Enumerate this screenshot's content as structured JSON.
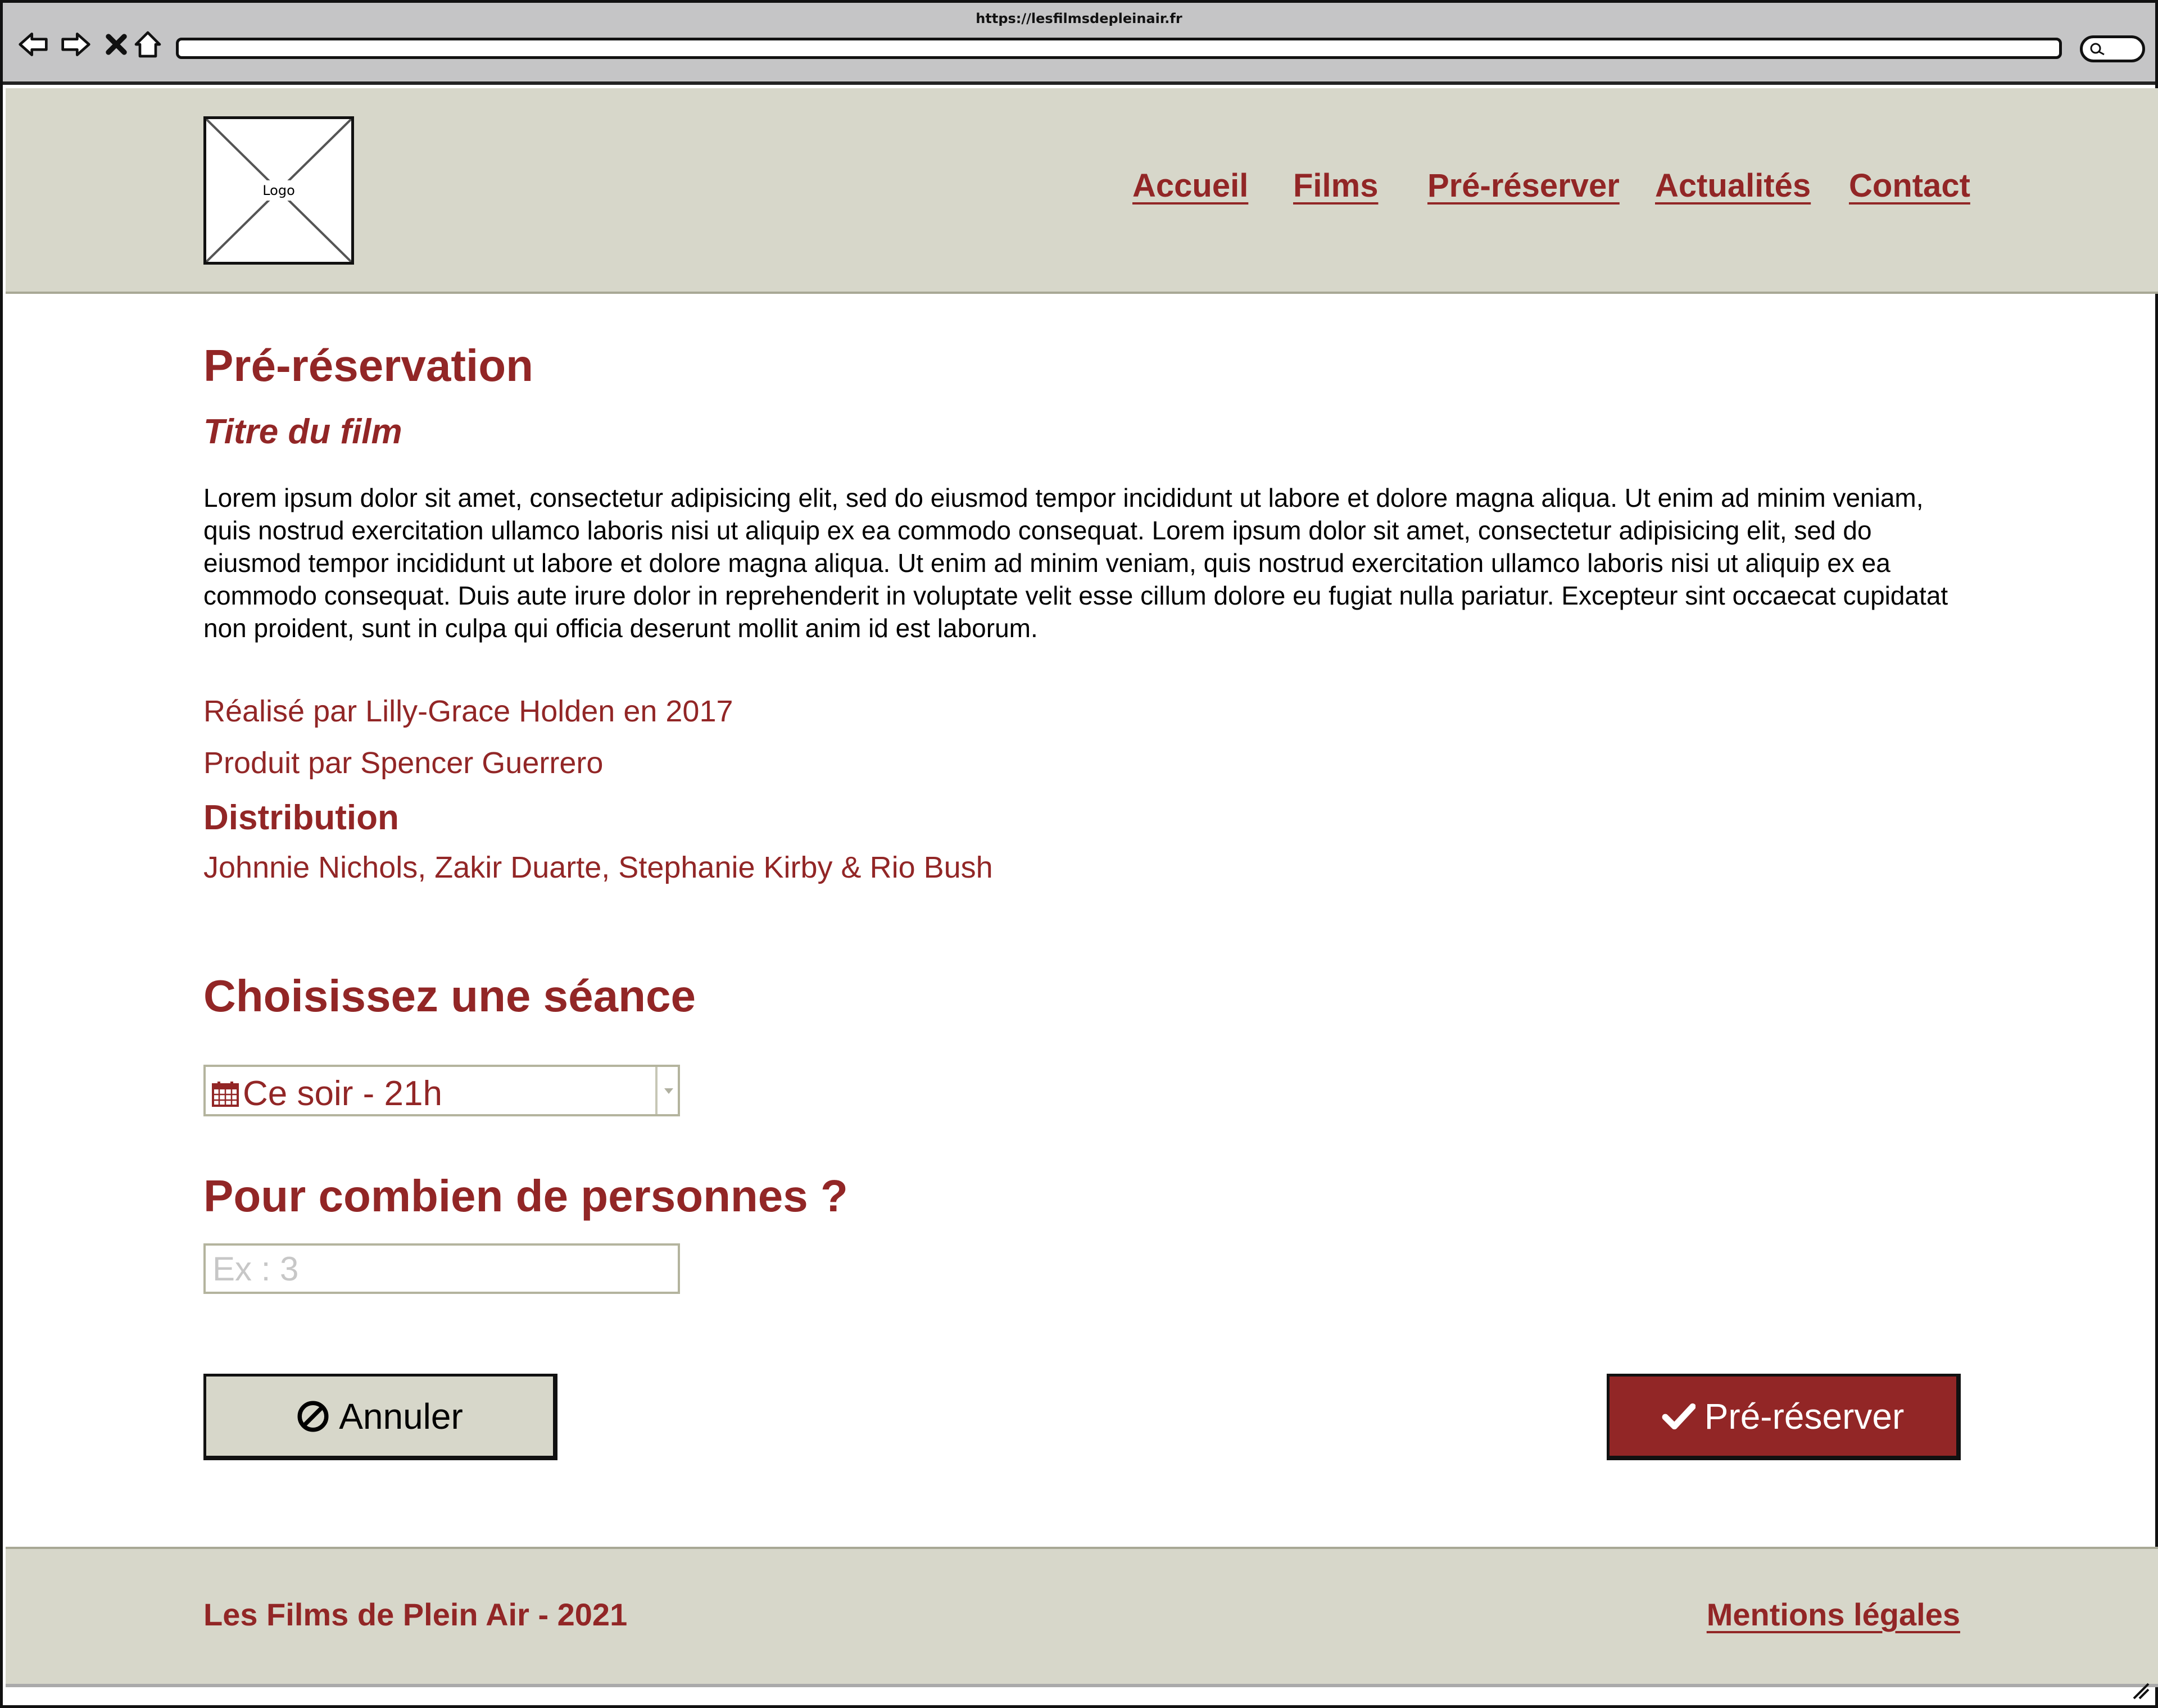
{
  "browser": {
    "url": "https://lesfilmsdepleinair.fr"
  },
  "header": {
    "logo_label": "Logo",
    "nav": [
      {
        "label": "Accueil"
      },
      {
        "label": "Films"
      },
      {
        "label": "Pré-réserver"
      },
      {
        "label": "Actualités"
      },
      {
        "label": "Contact"
      }
    ]
  },
  "main": {
    "page_title": "Pré-réservation",
    "film_title": "Titre du film",
    "synopsis": "Lorem ipsum dolor sit amet, consectetur adipisicing elit, sed do eiusmod tempor incididunt ut labore et dolore magna aliqua. Ut enim ad minim veniam, quis nostrud exercitation ullamco laboris nisi ut aliquip ex ea commodo consequat. Lorem ipsum dolor sit amet, consectetur adipisicing elit, sed do eiusmod tempor incididunt ut labore et dolore magna aliqua. Ut enim ad minim veniam, quis nostrud exercitation ullamco laboris nisi ut aliquip ex ea commodo consequat. Duis aute irure dolor in reprehenderit in voluptate velit esse cillum dolore eu fugiat nulla pariatur. Excepteur sint occaecat cupidatat non proident, sunt in culpa qui officia deserunt mollit anim id est laborum.",
    "director": "Réalisé par Lilly-Grace Holden en 2017",
    "producer": "Produit par Spencer Guerrero",
    "cast_heading": "Distribution",
    "cast": "Johnnie Nichols, Zakir Duarte, Stephanie Kirby & Rio Bush"
  },
  "form": {
    "session_heading": "Choisissez une séance",
    "session_value": "Ce soir - 21h",
    "people_heading": "Pour combien de personnes ?",
    "people_placeholder": "Ex : 3",
    "people_value": "",
    "cancel_label": "Annuler",
    "submit_label": "Pré-réserver"
  },
  "footer": {
    "copyright": "Les Films de Plein Air - 2021",
    "legal_link": "Mentions légales"
  },
  "colors": {
    "accent": "#922626",
    "header_bg": "#d7d7ca",
    "chrome_bg": "#c5c5c6",
    "placeholder": "#c7c7c7"
  },
  "icons": {
    "back": "back-arrow-icon",
    "forward": "forward-arrow-icon",
    "stop": "close-icon",
    "home": "home-icon",
    "search": "search-icon",
    "calendar": "calendar-icon",
    "cancel": "ban-icon",
    "submit": "check-icon"
  }
}
